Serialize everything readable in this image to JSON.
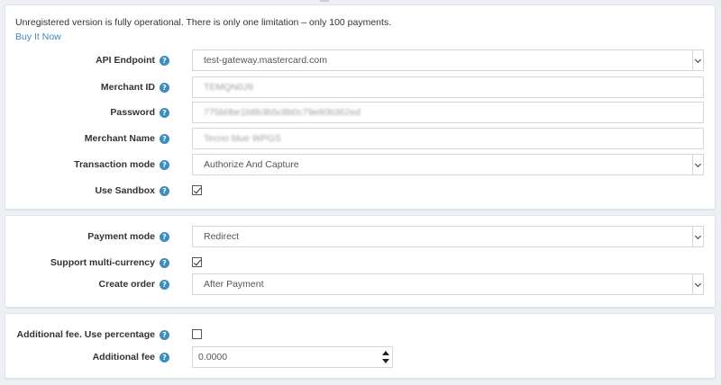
{
  "notice": {
    "text": "Unregistered version is fully operational. There is only one limitation – only 100 payments.",
    "buy_link": "Buy It Now"
  },
  "help_glyph": "?",
  "connection": {
    "api_endpoint": {
      "label": "API Endpoint",
      "value": "test-gateway.mastercard.com"
    },
    "merchant_id": {
      "label": "Merchant ID",
      "value": "TEMQN0J9"
    },
    "password": {
      "label": "Password",
      "value": "775b0be1b8b3b5c8b0c79e80b362ed"
    },
    "merchant_name": {
      "label": "Merchant Name",
      "value": "Tecno blue WPGS"
    },
    "transaction_mode": {
      "label": "Transaction mode",
      "value": "Authorize And Capture"
    },
    "use_sandbox": {
      "label": "Use Sandbox",
      "checked": true
    }
  },
  "payment": {
    "payment_mode": {
      "label": "Payment mode",
      "value": "Redirect"
    },
    "multi_currency": {
      "label": "Support multi-currency",
      "checked": true
    },
    "create_order": {
      "label": "Create order",
      "value": "After Payment"
    }
  },
  "fees": {
    "use_percentage": {
      "label": "Additional fee. Use percentage",
      "checked": false
    },
    "additional_fee": {
      "label": "Additional fee",
      "value": "0.0000"
    }
  },
  "colors": {
    "accent": "#3c8dbc",
    "page_bg": "#ecf0f5",
    "border": "#d2d6de"
  },
  "icons": {
    "help": "question-circle-icon",
    "select": "chevron-down-icon",
    "spinner": "up-down-arrows-icon"
  }
}
